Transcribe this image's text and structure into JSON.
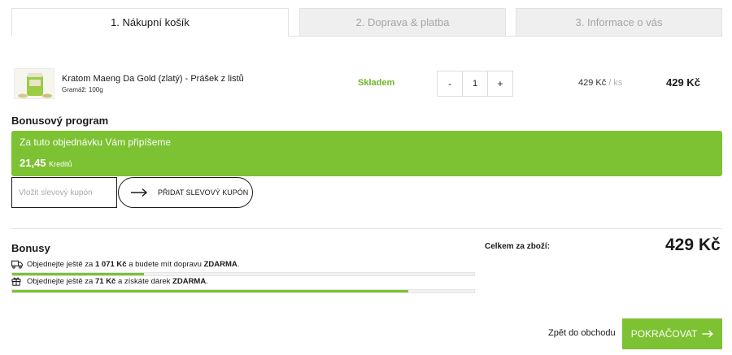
{
  "tabs": [
    {
      "label": "1. Nákupní košík"
    },
    {
      "label": "2. Doprava & platba"
    },
    {
      "label": "3. Informace o vás"
    }
  ],
  "cart_item": {
    "name": "Kratom Maeng Da Gold (zlatý) - Prášek z listů",
    "weight": "Gramáž: 100g",
    "stock": "Skladem",
    "qty_minus": "-",
    "quantity": "1",
    "qty_plus": "+",
    "unit_price": "429 Kč",
    "unit_suffix": "/ ks",
    "total": "429 Kč"
  },
  "bonus_program": {
    "heading": "Bonusový program",
    "text": "Za tuto objednávku Vám připíšeme",
    "credits_amount": "21,45",
    "credits_unit": "Kreditů"
  },
  "coupon": {
    "placeholder": "Vložit slevový kupón",
    "button_label": "PŘIDAT SLEVOVÝ KUPÓN"
  },
  "bonusy": {
    "heading": "Bonusy",
    "shipping": {
      "icon": "truck-icon",
      "prefix": "Objednejte ještě za",
      "amount": "1 071 Kč",
      "middle": "a budete mít dopravu",
      "reward": "ZDARMA",
      "end": ".",
      "progress": 0.286
    },
    "gift": {
      "icon": "gift-icon",
      "prefix": "Objednejte ještě za",
      "amount": "71 Kč",
      "middle": "a získáte dárek",
      "reward": "ZDARMA",
      "end": ".",
      "progress": 0.858
    }
  },
  "summary": {
    "label": "Celkem za zboží:",
    "value": "429 Kč"
  },
  "actions": {
    "back_label": "Zpět do obchodu",
    "continue_label": "POKRAČOVAT"
  },
  "colors": {
    "accent": "#7cc232",
    "stock": "#6eb528"
  }
}
